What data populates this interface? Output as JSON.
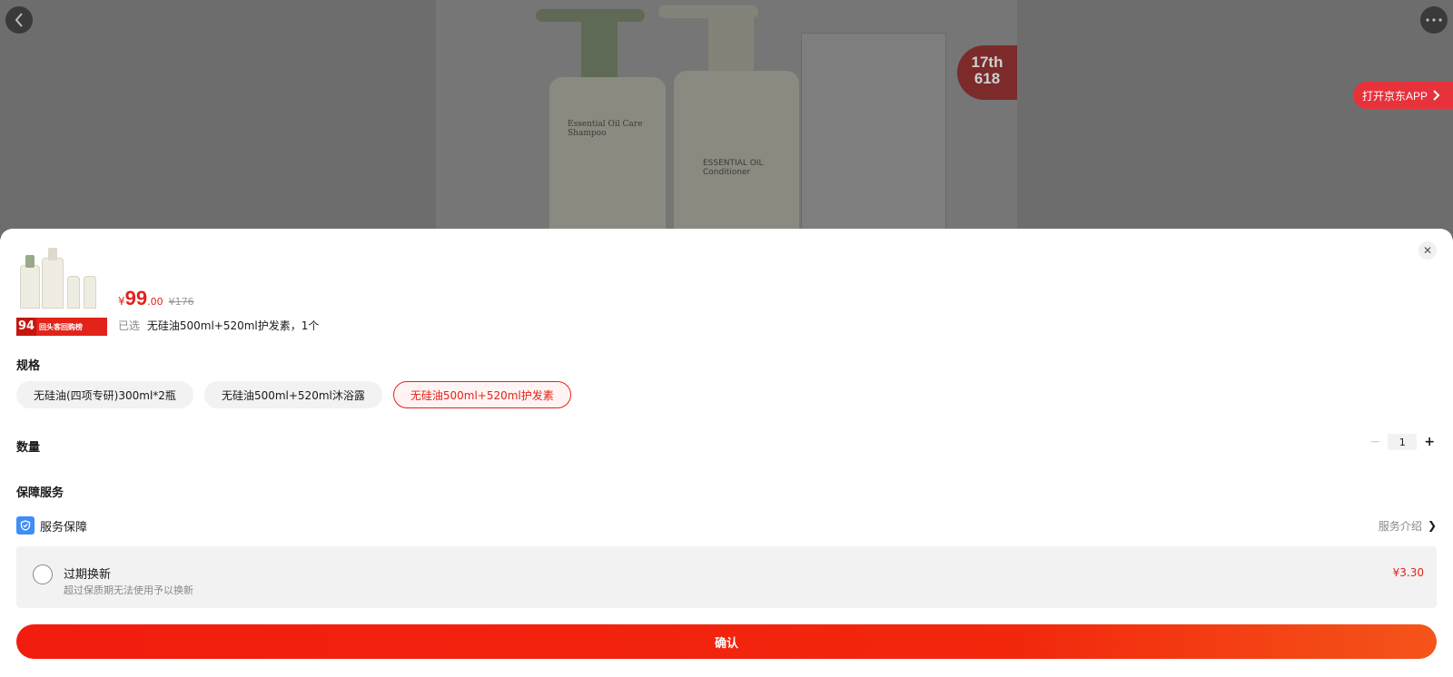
{
  "nav": {
    "back_icon": "chevron-left-icon",
    "more_icon": "more-dots-icon",
    "open_app_label": "打开京东APP"
  },
  "hero": {
    "bottle1_label": "Essential Oil Care Shampoo",
    "bottle2_label": "ESSENTIAL OIL Conditioner",
    "badge_top": "17th",
    "badge_bottom": "618"
  },
  "product": {
    "thumb_rank": "94",
    "thumb_banner_text": "回头客回购榜",
    "currency": "¥",
    "price_int": "99",
    "price_dec": ".00",
    "original_price": "¥176",
    "selected_prefix": "已选",
    "selected_value": "无硅油500ml+520ml护发素，1个"
  },
  "spec": {
    "title": "规格",
    "options": [
      {
        "label": "无硅油(四项专研)300ml*2瓶",
        "selected": false
      },
      {
        "label": "无硅油500ml+520ml沐浴露",
        "selected": false
      },
      {
        "label": "无硅油500ml+520ml护发素",
        "selected": true
      }
    ]
  },
  "quantity": {
    "title": "数量",
    "value": "1",
    "minus": "−",
    "plus": "+"
  },
  "service": {
    "title": "保障服务",
    "row_label": "服务保障",
    "intro_label": "服务介绍",
    "item": {
      "name": "过期换新",
      "desc": "超过保质期无法使用予以换新",
      "price": "¥3.30",
      "checked": false
    }
  },
  "confirm_label": "确认",
  "colors": {
    "accent": "#e2231a",
    "shield": "#3e8ef7"
  }
}
